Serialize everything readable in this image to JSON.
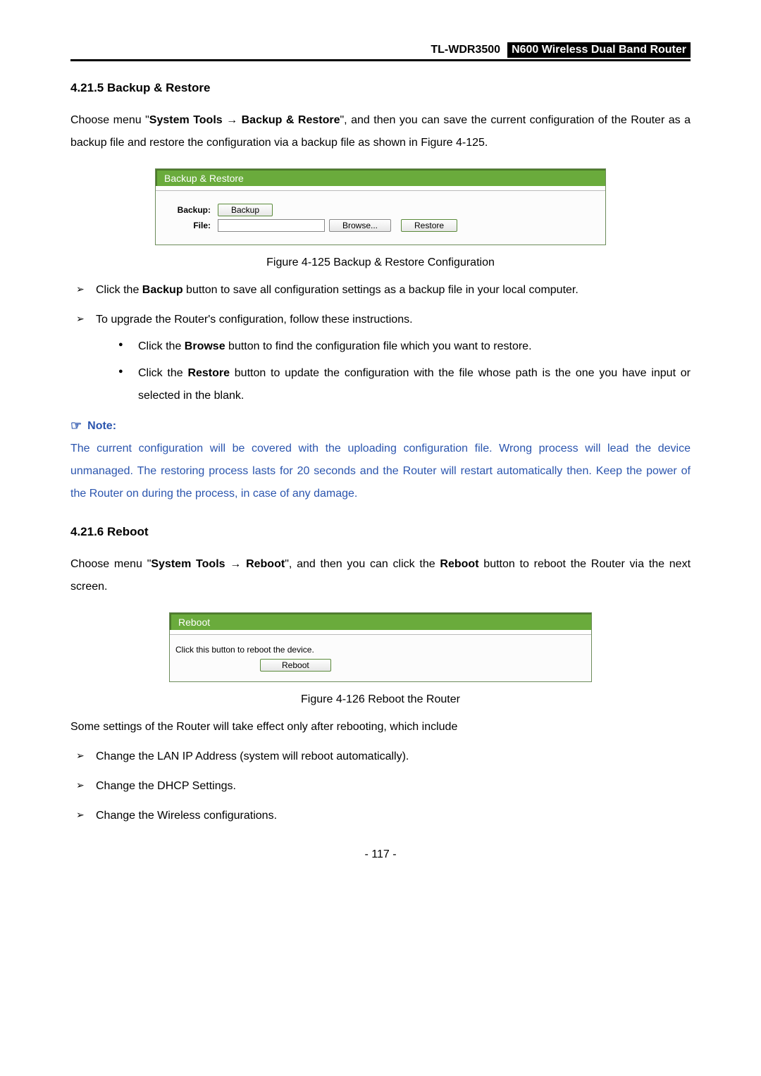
{
  "header": {
    "model": "TL-WDR3500",
    "product_name": "N600 Wireless Dual Band Router"
  },
  "section1": {
    "number_title": "4.21.5  Backup & Restore",
    "intro_pre": "Choose menu \"",
    "intro_b1": "System Tools",
    "intro_arrow": " → ",
    "intro_b2": "Backup & Restore",
    "intro_post": "\", and then you can save the current configuration of the Router as a backup file and restore the configuration via a backup file as shown in Figure 4-125.",
    "panel": {
      "title": "Backup & Restore",
      "backup_label": "Backup:",
      "backup_button": "Backup",
      "file_label": "File:",
      "browse_button": "Browse...",
      "restore_button": "Restore"
    },
    "caption": "Figure 4-125 Backup & Restore Configuration",
    "b1_pre": "Click the ",
    "b1_bold": "Backup",
    "b1_post": " button to save all configuration settings as a backup file in your local computer.",
    "b2": "To upgrade the Router's configuration, follow these instructions.",
    "s1_pre": "Click the ",
    "s1_bold": "Browse",
    "s1_post": " button to find the configuration file which you want to restore.",
    "s2_pre": "Click the ",
    "s2_bold": "Restore",
    "s2_post": " button to update the configuration with the file whose path is the one you have input or selected in the blank.",
    "note_label": "Note:",
    "note_text": "The current configuration will be covered with the uploading configuration file. Wrong process will lead the device unmanaged. The restoring process lasts for 20 seconds and the Router will restart automatically then. Keep the power of the Router on during the process, in case of any damage."
  },
  "section2": {
    "number_title": "4.21.6  Reboot",
    "intro_pre": "Choose menu \"",
    "intro_b1": "System Tools",
    "intro_arrow": " → ",
    "intro_b2": "Reboot",
    "intro_mid": "\", and then you can click the ",
    "intro_b3": "Reboot",
    "intro_post": " button to reboot the Router via the next screen.",
    "panel": {
      "title": "Reboot",
      "body_text": "Click this button to reboot the device.",
      "reboot_button": "Reboot"
    },
    "caption": "Figure 4-126 Reboot the Router",
    "outro": "Some settings of the Router will take effect only after rebooting, which include",
    "list1": "Change the LAN IP Address (system will reboot automatically).",
    "list2": "Change the DHCP Settings.",
    "list3": "Change the Wireless configurations."
  },
  "page_number": "- 117 -"
}
